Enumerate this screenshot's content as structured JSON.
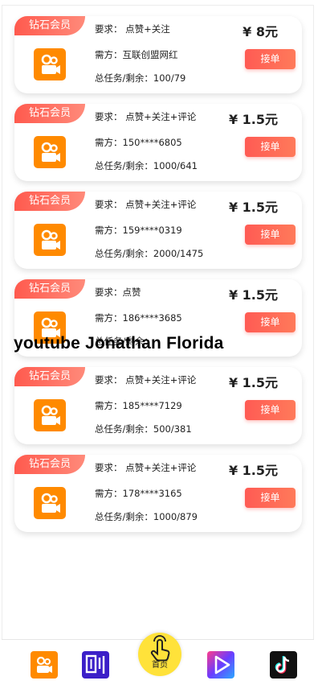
{
  "currency": "¥",
  "badge_label": "钻石会员",
  "button_label": "接单",
  "orders": [
    {
      "requirement": "要求：  点赞+关注",
      "client": "需方：互联创盟网红",
      "progress": "总任务/剩余：100/79",
      "price": "¥ 8元"
    },
    {
      "requirement": "要求：  点赞+关注+评论",
      "client": "需方：150****6805",
      "progress": "总任务/剩余：1000/641",
      "price": "¥ 1.5元"
    },
    {
      "requirement": "要求：  点赞+关注+评论",
      "client": "需方：159****0319",
      "progress": "总任务/剩余：2000/1475",
      "price": "¥ 1.5元"
    },
    {
      "requirement": "要求：点赞",
      "client": "需方：186****3685",
      "progress": "总任务/剩余：",
      "price": "¥ 1.5元"
    },
    {
      "requirement": "要求：  点赞+关注+评论",
      "client": "需方：185****7129",
      "progress": "总任务/剩余：500/381",
      "price": "¥ 1.5元"
    },
    {
      "requirement": "要求：  点赞+关注+评论",
      "client": "需方：178****3165",
      "progress": "总任务/剩余：1000/879",
      "price": "¥ 1.5元"
    }
  ],
  "overlay_text": "youtube Jonathan Florida",
  "bottom_nav": {
    "home_label": "首页",
    "tabs": [
      "kuaishou-app",
      "shua-app",
      "home",
      "video-app",
      "douyin-app"
    ]
  },
  "colors": {
    "accent": "#ff5b54",
    "badge_gradient_end": "#ff8a7a",
    "app_orange": "#ff8a00",
    "home_yellow": "#ffe23a"
  }
}
